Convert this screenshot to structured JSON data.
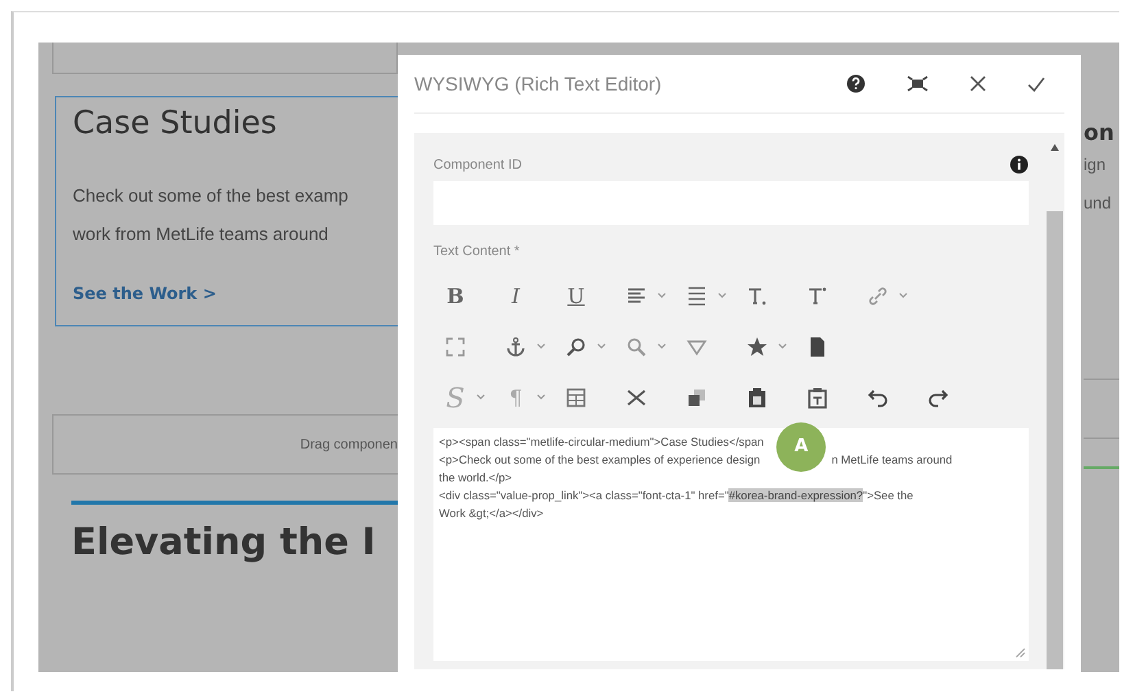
{
  "page": {
    "card": {
      "title": "Case Studies",
      "body_lines": [
        "Check out some of the best examp",
        "work from MetLife teams around"
      ],
      "link": "See the Work >",
      "selected": true
    },
    "drop_zone": "Drag componen",
    "heading": "Elevating the I",
    "right_edge": {
      "title": "on",
      "body_lines": [
        "ign",
        "und"
      ]
    }
  },
  "dialog": {
    "title": "WYSIWYG (Rich Text Editor)",
    "actions": [
      {
        "kind": "help"
      },
      {
        "kind": "fullscreen"
      },
      {
        "kind": "close"
      },
      {
        "kind": "confirm"
      }
    ],
    "component_id": {
      "label": "Component ID"
    },
    "text_content": {
      "label": "Text Content *"
    },
    "toolbar": [
      [
        {
          "kind": "bold",
          "label": "B",
          "menu": false
        },
        {
          "kind": "italic",
          "label": "I",
          "menu": false
        },
        {
          "kind": "underline",
          "label": "U",
          "menu": false
        },
        {
          "kind": "align",
          "menu": true
        },
        {
          "kind": "list",
          "menu": true
        },
        {
          "kind": "subscript",
          "menu": false
        },
        {
          "kind": "superscript",
          "menu": false
        },
        {
          "kind": "link",
          "menu": true
        }
      ],
      [
        {
          "kind": "fullscreen",
          "menu": false
        },
        {
          "kind": "anchor",
          "menu": true
        },
        {
          "kind": "find",
          "menu": true
        },
        {
          "kind": "replace",
          "menu": true
        },
        {
          "kind": "spellcheck",
          "menu": false
        },
        {
          "kind": "star",
          "menu": true
        },
        {
          "kind": "document",
          "menu": false
        }
      ],
      [
        {
          "kind": "styles",
          "label": "S",
          "menu": true
        },
        {
          "kind": "paragraph",
          "label": "¶",
          "menu": true
        },
        {
          "kind": "table",
          "menu": false
        },
        {
          "kind": "cut",
          "menu": false
        },
        {
          "kind": "copy",
          "menu": false
        },
        {
          "kind": "paste",
          "menu": false
        },
        {
          "kind": "paste-text",
          "menu": false
        },
        {
          "kind": "undo",
          "menu": false
        },
        {
          "kind": "redo",
          "menu": false
        }
      ]
    ],
    "code": {
      "line_1": "<p><span class=\"metlife-circular-medium\">Case Studies</span",
      "line_2_before": "<p>Check out some of the best examples of experience design",
      "marker": "A",
      "line_2_after": "n MetLife teams around",
      "line_3": "the world.</p>",
      "line_4_before": "<div class=\"value-prop_link\"><a class=\"font-cta-1\" href=\"",
      "line_4_highlight": "#korea-brand-expression?",
      "line_4_after": "\">See the",
      "line_5": "Work &gt;</a></div>"
    }
  }
}
